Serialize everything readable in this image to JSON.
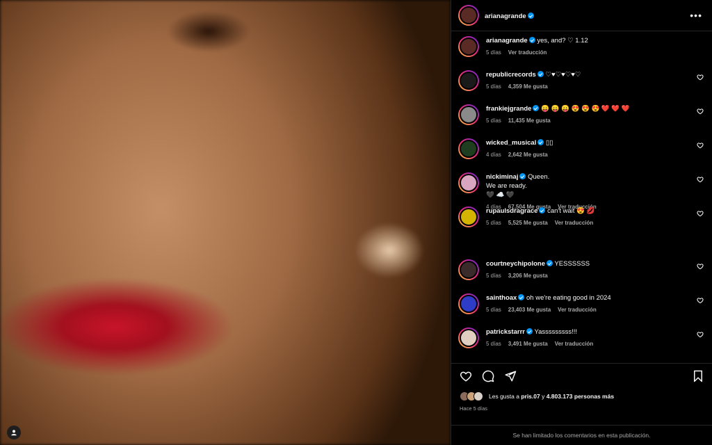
{
  "post": {
    "author": "arianagrande",
    "verified": true
  },
  "caption": {
    "username": "arianagrande",
    "text": "yes, and? ♡ 1.12",
    "time": "5 días",
    "translate": "Ver traducción"
  },
  "comments": [
    {
      "username": "republicrecords",
      "text": "♡♥♡♥♡♥♡",
      "time": "5 días",
      "likes": "4,359 Me gusta",
      "translate": "",
      "avatar_color": "#1a1a1a"
    },
    {
      "username": "frankiejgrande",
      "text": "😛 😛 😛 😍 😍 😍 ❤️ ❤️ ❤️",
      "time": "5 días",
      "likes": "11,435 Me gusta",
      "translate": "",
      "avatar_color": "#8a8a8a"
    },
    {
      "username": "wicked_musical",
      "text": "▯▯",
      "time": "4 días",
      "likes": "2,642 Me gusta",
      "translate": "",
      "avatar_color": "#1f3d1f"
    },
    {
      "username": "nickiminaj",
      "text": "Queen.\nWe are ready.\n🖤 ☁️ 🖤",
      "time": "4 días",
      "likes": "67,504 Me gusta",
      "translate": "Ver traducción",
      "avatar_color": "#d9a6c2"
    },
    {
      "username": "rupaulsdragrace",
      "text": "can't wait 😍 💋",
      "time": "5 días",
      "likes": "5,525 Me gusta",
      "translate": "Ver traducción",
      "avatar_color": "#d4b400"
    },
    {
      "username": "courtneychipolone",
      "text": "YESSSSSS",
      "time": "5 días",
      "likes": "3,206 Me gusta",
      "translate": "",
      "avatar_color": "#3a2a2a"
    },
    {
      "username": "sainthoax",
      "text": "oh we're eating good in 2024",
      "time": "5 días",
      "likes": "23,403 Me gusta",
      "translate": "Ver traducción",
      "avatar_color": "#2f3cc8"
    },
    {
      "username": "patrickstarrr",
      "text": "Yasssssssss!!!",
      "time": "5 días",
      "likes": "3,491 Me gusta",
      "translate": "Ver traducción",
      "avatar_color": "#e0cfc0"
    }
  ],
  "likes_line": {
    "prefix": "Les gusta a ",
    "user": "pris.07",
    "middle": " y ",
    "others": "4.803.173 personas más"
  },
  "date": "Hace 5 días",
  "comments_limited": "Se han limitado los comentarios en esta publicación.",
  "colors": {
    "verified": "#0095f6",
    "ring": "#ee2a7b"
  }
}
